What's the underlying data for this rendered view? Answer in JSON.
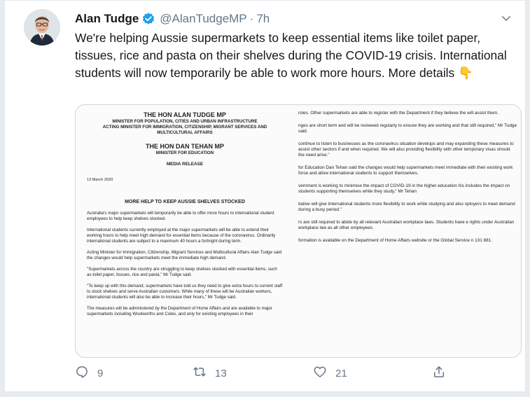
{
  "tweet": {
    "author_name": "Alan Tudge",
    "handle": "@AlanTudgeMP",
    "separator": "·",
    "time": "7h",
    "text": "We're helping Aussie supermarkets to keep essential items like toilet paper, tissues, rice and pasta on their shelves during the COVID-19 crisis. International students will now temporarily be able to work more hours. More details 👇",
    "reply_count": "9",
    "retweet_count": "13",
    "like_count": "21"
  },
  "icons": {
    "verified": "verified-badge-icon",
    "caret": "chevron-down-icon",
    "reply": "reply-icon",
    "retweet": "retweet-icon",
    "like": "heart-icon",
    "share": "share-icon"
  },
  "colors": {
    "accent": "#1da1f2",
    "secondary_text": "#657786",
    "background": "#e6ecf0"
  },
  "media": {
    "title_1": "THE HON ALAN TUDGE MP",
    "role_1": "MINISTER FOR POPULATION, CITIES AND URBAN INFRASTRUCTURE",
    "role_2": "ACTING MINISTER FOR IMMIGRATION, CITIZENSHIP, MIGRANT SERVICES AND",
    "role_3": "MULTICULTURAL AFFAIRS",
    "title_2": "THE HON DAN TEHAN MP",
    "role_4": "MINISTER FOR EDUCATION",
    "release_label": "MEDIA RELEASE",
    "date": "13 March 2020",
    "heading": "MORE HELP TO KEEP AUSSIE SHELVES STOCKED",
    "left_paragraphs": [
      "Australia's major supermarkets will temporarily be able to offer more hours to international student employees to help keep shelves stocked.",
      "International students currently employed at the major supermarkets will be able to extend their working hours to help meet high demand for essential items because of the coronavirus. Ordinarily international students are subject to a maximum 40 hours a fortnight during term.",
      "Acting Minister for Immigration, Citizenship, Migrant Services and Multicultural Affairs Alan Tudge said the changes would help supermarkets meet the immediate high demand.",
      "\"Supermarkets across the country are struggling to keep shelves stocked with essential items, such as toilet paper, tissues, rice and pasta,\" Mr Tudge said.",
      "\"To keep up with this demand, supermarkets have told us they need to give extra hours to current staff to stock shelves and serve Australian customers. While many of these will be Australian workers, international students will also be able to increase their hours,\" Mr Tudge said.",
      "The measures will be administered by the Department of Home Affairs and are available to major supermarkets including Woolworths and Coles, and only for existing employees in their"
    ],
    "right_paragraphs": [
      "roles. Other supermarkets are able to register with the Department if they believe the will assist them.",
      "nges are short term and will be reviewed regularly to ensure they are working and that still required,\" Mr Tudge said.",
      "continue to listen to businesses as the coronavirus situation develops and may expanding these measures to assist other sectors if and when required. We will also providing flexibility with other temporary visas should the need arise.\"",
      "for Education Dan Tehan said the changes would help supermarkets meet immediate with their existing work force and allow international students to support themselves.",
      "vernment is working to minimise the impact of COVID-19 in the higher education his includes the impact on students supporting themselves while they study,\" Mr Tehan",
      "tiative will give international students more flexibility to work while studying and also nployers to meet demand during a busy period.\"",
      "rs are still required to abide by all relevant Australian workplace laws. Students have e rights under Australian workplace law as all other employees.",
      "formation is available on the Department of Home Affairs website or the Global Service n 131 881."
    ]
  }
}
